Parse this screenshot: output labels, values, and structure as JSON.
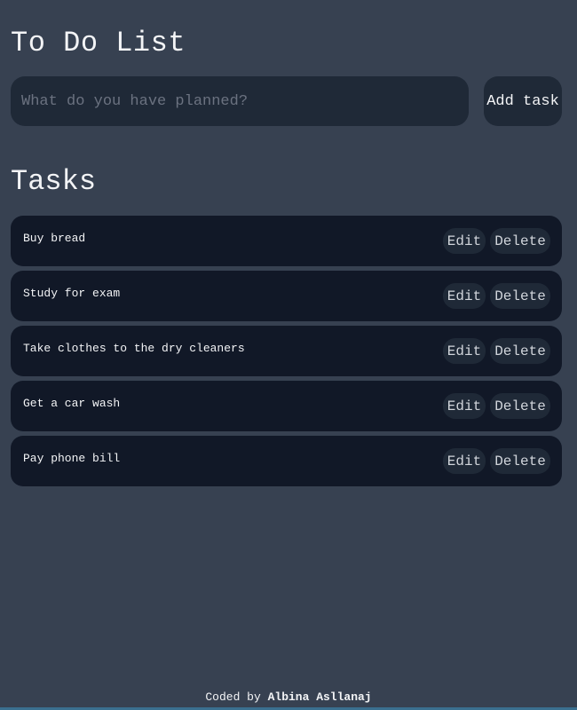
{
  "app": {
    "title": "To Do List"
  },
  "new_task": {
    "placeholder": "What do you have planned?",
    "value": "",
    "add_label": "Add task"
  },
  "tasks_heading": "Tasks",
  "tasks": [
    {
      "text": "Buy bread",
      "edit_label": "Edit",
      "delete_label": "Delete"
    },
    {
      "text": "Study for exam",
      "edit_label": "Edit",
      "delete_label": "Delete"
    },
    {
      "text": "Take clothes to the dry cleaners",
      "edit_label": "Edit",
      "delete_label": "Delete"
    },
    {
      "text": "Get a car wash",
      "edit_label": "Edit",
      "delete_label": "Delete"
    },
    {
      "text": "Pay phone bill",
      "edit_label": "Edit",
      "delete_label": "Delete"
    }
  ],
  "footer": {
    "prefix": "Coded by",
    "author": "Albina Asllanaj"
  },
  "colors": {
    "page_background": "#374151",
    "input_background": "#1f2937",
    "task_background": "#111827",
    "text": "#f3f4f6",
    "placeholder": "#6b7280"
  }
}
